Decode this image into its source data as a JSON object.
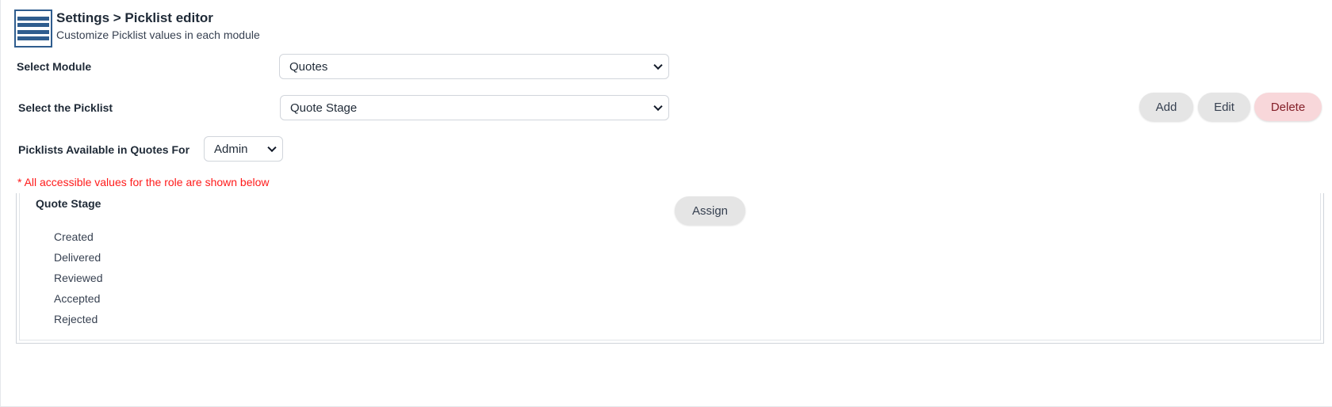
{
  "header": {
    "icon": "list-icon",
    "title": "Settings > Picklist editor",
    "subtitle": "Customize Picklist values in each module"
  },
  "module": {
    "label": "Select Module",
    "selected": "Quotes"
  },
  "picklist": {
    "label": "Select the Picklist",
    "selected": "Quote Stage"
  },
  "role": {
    "label": "Picklists Available in Quotes For",
    "selected": "Admin"
  },
  "actions": {
    "add": "Add",
    "edit": "Edit",
    "delete": "Delete"
  },
  "note": "* All accessible values for the role are shown below",
  "values_panel": {
    "title": "Quote Stage",
    "assign": "Assign",
    "values": [
      "Created",
      "Delivered",
      "Reviewed",
      "Accepted",
      "Rejected"
    ]
  },
  "colors": {
    "accent": "#2f5d8e",
    "note_red": "#ff1a1a",
    "delete_bg": "#f8d7da",
    "delete_text": "#842029",
    "button_grey": "#e5e5e5"
  }
}
